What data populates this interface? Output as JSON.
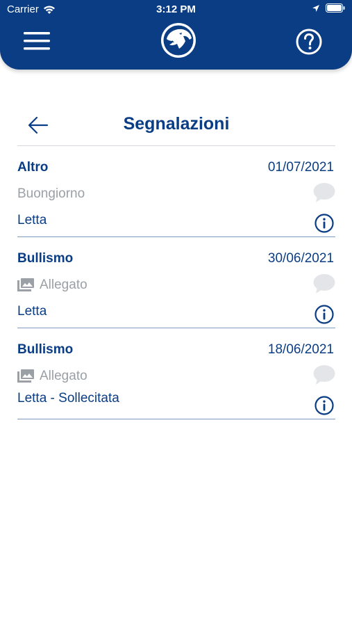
{
  "status_bar": {
    "carrier": "Carrier",
    "time": "3:12 PM"
  },
  "header": {
    "menu_icon": "hamburger-menu-icon",
    "logo_icon": "panther-logo",
    "help_icon": "help-question-icon",
    "bg_color": "#0a3d84"
  },
  "page": {
    "title": "Segnalazioni",
    "back_icon": "arrow-left-icon"
  },
  "reports": [
    {
      "category": "Altro",
      "date": "01/07/2021",
      "message": "Buongiorno",
      "has_attachment": false,
      "status": "Letta"
    },
    {
      "category": "Bullismo",
      "date": "30/06/2021",
      "message": "Allegato",
      "has_attachment": true,
      "status": "Letta"
    },
    {
      "category": "Bullismo",
      "date": "18/06/2021",
      "message": "Allegato",
      "has_attachment": true,
      "status": "Letta - Sollecitata"
    }
  ],
  "colors": {
    "primary": "#0a3d84",
    "muted_text": "#9aa0a6",
    "bubble": "#e3e5e8"
  }
}
